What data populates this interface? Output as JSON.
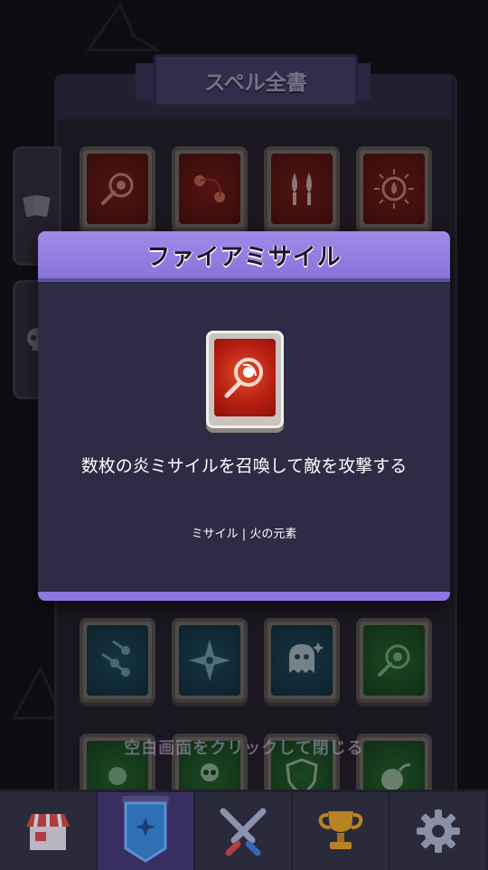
{
  "book": {
    "title": "スペル全書",
    "side_tabs": [
      "cards-icon",
      "skull-icon"
    ],
    "cards_top": [
      {
        "icon": "fire-missile-icon",
        "color": "red"
      },
      {
        "icon": "fire-orbs-icon",
        "color": "red"
      },
      {
        "icon": "twin-drops-icon",
        "color": "red"
      },
      {
        "icon": "fire-burst-icon",
        "color": "red"
      }
    ],
    "cards_middle": [
      {
        "icon": "meteor-shower-icon",
        "color": "blue"
      },
      {
        "icon": "shuriken-icon",
        "color": "blue"
      },
      {
        "icon": "ghost-icon",
        "color": "blue"
      },
      {
        "icon": "comet-icon",
        "color": "green"
      }
    ],
    "cards_bottom": [
      {
        "icon": "orb-icon",
        "color": "green"
      },
      {
        "icon": "skull-bones-icon",
        "color": "green"
      },
      {
        "icon": "shield-skull-icon",
        "color": "green"
      },
      {
        "icon": "bomb-icon",
        "color": "green"
      }
    ]
  },
  "modal": {
    "title": "ファイアミサイル",
    "icon": "fire-missile-icon",
    "description": "数枚の炎ミサイルを召喚して敵を攻撃する",
    "tags": "ミサイル | 火の元素"
  },
  "close_hint": "空白画面をクリックして閉じる",
  "nav": {
    "items": [
      {
        "name": "shop",
        "icon": "shop-icon"
      },
      {
        "name": "spellbook",
        "icon": "spellbook-banner-icon",
        "active": true
      },
      {
        "name": "battle",
        "icon": "crossed-swords-icon"
      },
      {
        "name": "trophy",
        "icon": "trophy-icon"
      },
      {
        "name": "settings",
        "icon": "gear-icon"
      }
    ]
  },
  "colors": {
    "modal_header": "#8a73da",
    "modal_body": "#2e2b45",
    "spell_red": "#b81f12",
    "nav_active": "#3a2f63"
  }
}
